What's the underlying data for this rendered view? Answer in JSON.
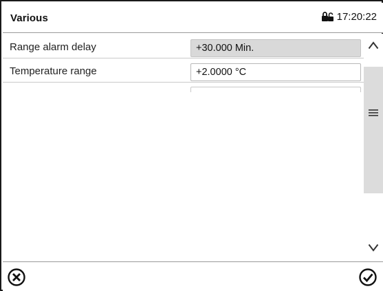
{
  "header": {
    "title": "Various",
    "time": "17:20:22",
    "lock_icon": "lock-icon"
  },
  "rows": [
    {
      "label": "Range alarm delay",
      "value": "+30.000 Min.",
      "readonly": true
    },
    {
      "label": "Temperature range",
      "value": "+2.0000 °C",
      "readonly": false
    }
  ],
  "scrollbar": {
    "up_icon": "chevron-up-icon",
    "down_icon": "chevron-down-icon",
    "thumb_icon": "menu-lines-icon"
  },
  "footer": {
    "cancel_icon": "cancel-circle-icon",
    "confirm_icon": "confirm-check-icon"
  }
}
